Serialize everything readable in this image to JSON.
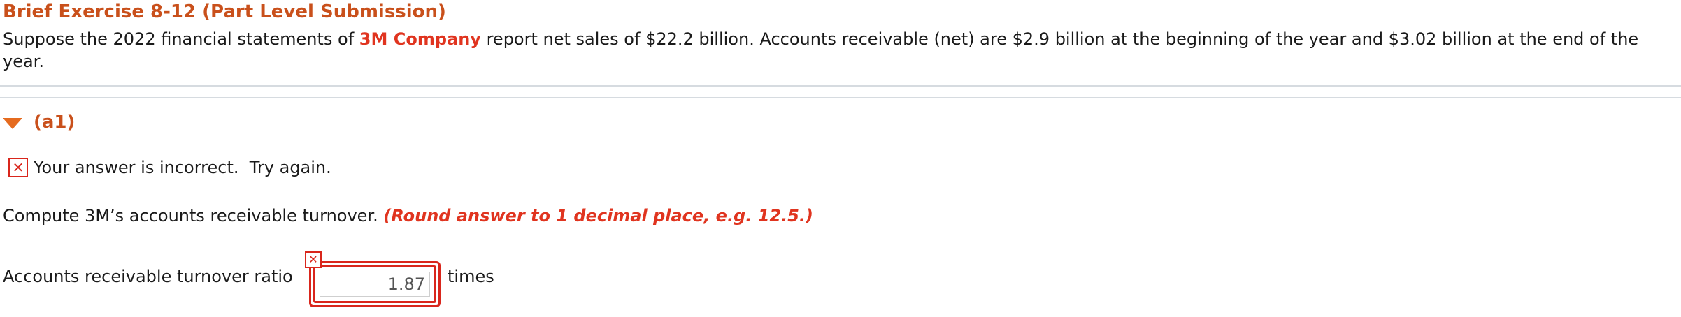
{
  "exercise": {
    "title": "Brief Exercise 8-12 (Part Level Submission)",
    "problem_before": "Suppose the 2022 financial statements of ",
    "company": "3M Company",
    "problem_after": " report net sales of $22.2 billion. Accounts receivable (net) are $2.9 billion at the beginning of the year and $3.02 billion at the end of the year."
  },
  "part": {
    "label": "(a1)",
    "expanded": true
  },
  "feedback": {
    "icon": "x-mark-icon",
    "symbol": "✕",
    "text": "Your answer is incorrect.  Try again."
  },
  "question": {
    "instruction": "Compute 3M’s accounts receivable turnover. ",
    "hint": "(Round answer to 1 decimal place, e.g. 12.5.)"
  },
  "answer": {
    "label": "Accounts receivable turnover ratio",
    "value": "1.87",
    "unit": "times",
    "status": "incorrect",
    "status_symbol": "✕"
  },
  "colors": {
    "title": "#c9501b",
    "company": "#e0341f",
    "error": "#d9261c",
    "caret": "#e56b1f",
    "divider": "#d6dbe0"
  }
}
